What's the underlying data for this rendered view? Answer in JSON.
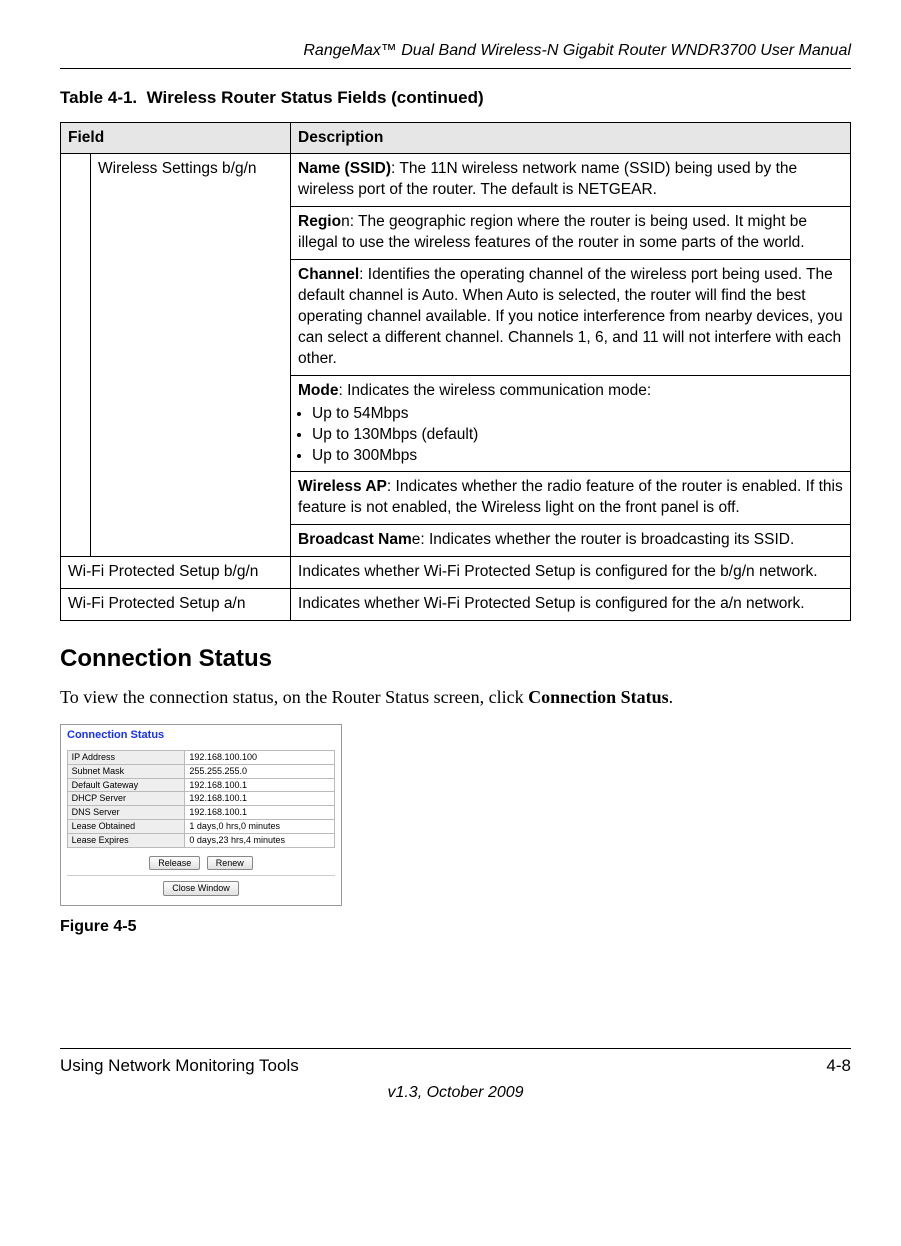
{
  "header": {
    "doc_title": "RangeMax™ Dual Band Wireless-N Gigabit Router WNDR3700 User Manual"
  },
  "table": {
    "caption_prefix": "Table 4-1.",
    "caption_text": "Wireless Router Status Fields (continued)",
    "head_field": "Field",
    "head_desc": "Description",
    "wireless_settings_label": "Wireless Settings b/g/n",
    "rows": {
      "name_ssid_bold": "Name (SSID)",
      "name_ssid_rest": ": The 11N wireless network name (SSID) being used by the wireless port of the router. The default is NETGEAR.",
      "region_bold": "Regio",
      "region_rest": "n: The geographic region where the router is being used. It might be illegal to use the wireless features of the router in some parts of the world.",
      "channel_bold": "Channel",
      "channel_rest": ": Identifies the operating channel of the wireless port being used. The default channel is Auto. When Auto is selected, the router will find the best operating channel available. If you notice interference from nearby devices, you can select a different channel. Channels 1, 6, and 11 will not interfere with each other.",
      "mode_bold": "Mode",
      "mode_rest": ": Indicates the wireless communication mode:",
      "mode_bullets": [
        "Up to 54Mbps",
        "Up to 130Mbps (default)",
        "Up to 300Mbps"
      ],
      "wap_bold": "Wireless AP",
      "wap_rest": ": Indicates whether the radio feature of the router is enabled. If this feature is not enabled, the Wireless light on the front panel is off.",
      "bcast_bold": "Broadcast Nam",
      "bcast_rest": "e: Indicates whether the router is broadcasting its SSID.",
      "wps_bgn_field": "Wi-Fi Protected Setup b/g/n",
      "wps_bgn_desc": "Indicates whether Wi-Fi Protected Setup is configured for the b/g/n network.",
      "wps_an_field": "Wi-Fi Protected Setup a/n",
      "wps_an_desc": "Indicates whether Wi-Fi Protected Setup is configured for the a/n network."
    }
  },
  "section": {
    "heading": "Connection Status",
    "intro_pre": "To view the connection status, on the Router Status screen, click ",
    "intro_bold": "Connection Status",
    "intro_post": "."
  },
  "cs_panel": {
    "title": "Connection Status",
    "rows": [
      {
        "label": "IP Address",
        "value": "192.168.100.100"
      },
      {
        "label": "Subnet Mask",
        "value": "255.255.255.0"
      },
      {
        "label": "Default Gateway",
        "value": "192.168.100.1"
      },
      {
        "label": "DHCP Server",
        "value": "192.168.100.1"
      },
      {
        "label": "DNS Server",
        "value": "192.168.100.1"
      },
      {
        "label": "Lease Obtained",
        "value": "1 days,0 hrs,0 minutes"
      },
      {
        "label": "Lease Expires",
        "value": "0 days,23 hrs,4 minutes"
      }
    ],
    "btn_release": "Release",
    "btn_renew": "Renew",
    "btn_close": "Close Window"
  },
  "figure_label": "Figure 4-5",
  "footer": {
    "left": "Using Network Monitoring Tools",
    "right": "4-8",
    "version": "v1.3, October 2009"
  }
}
